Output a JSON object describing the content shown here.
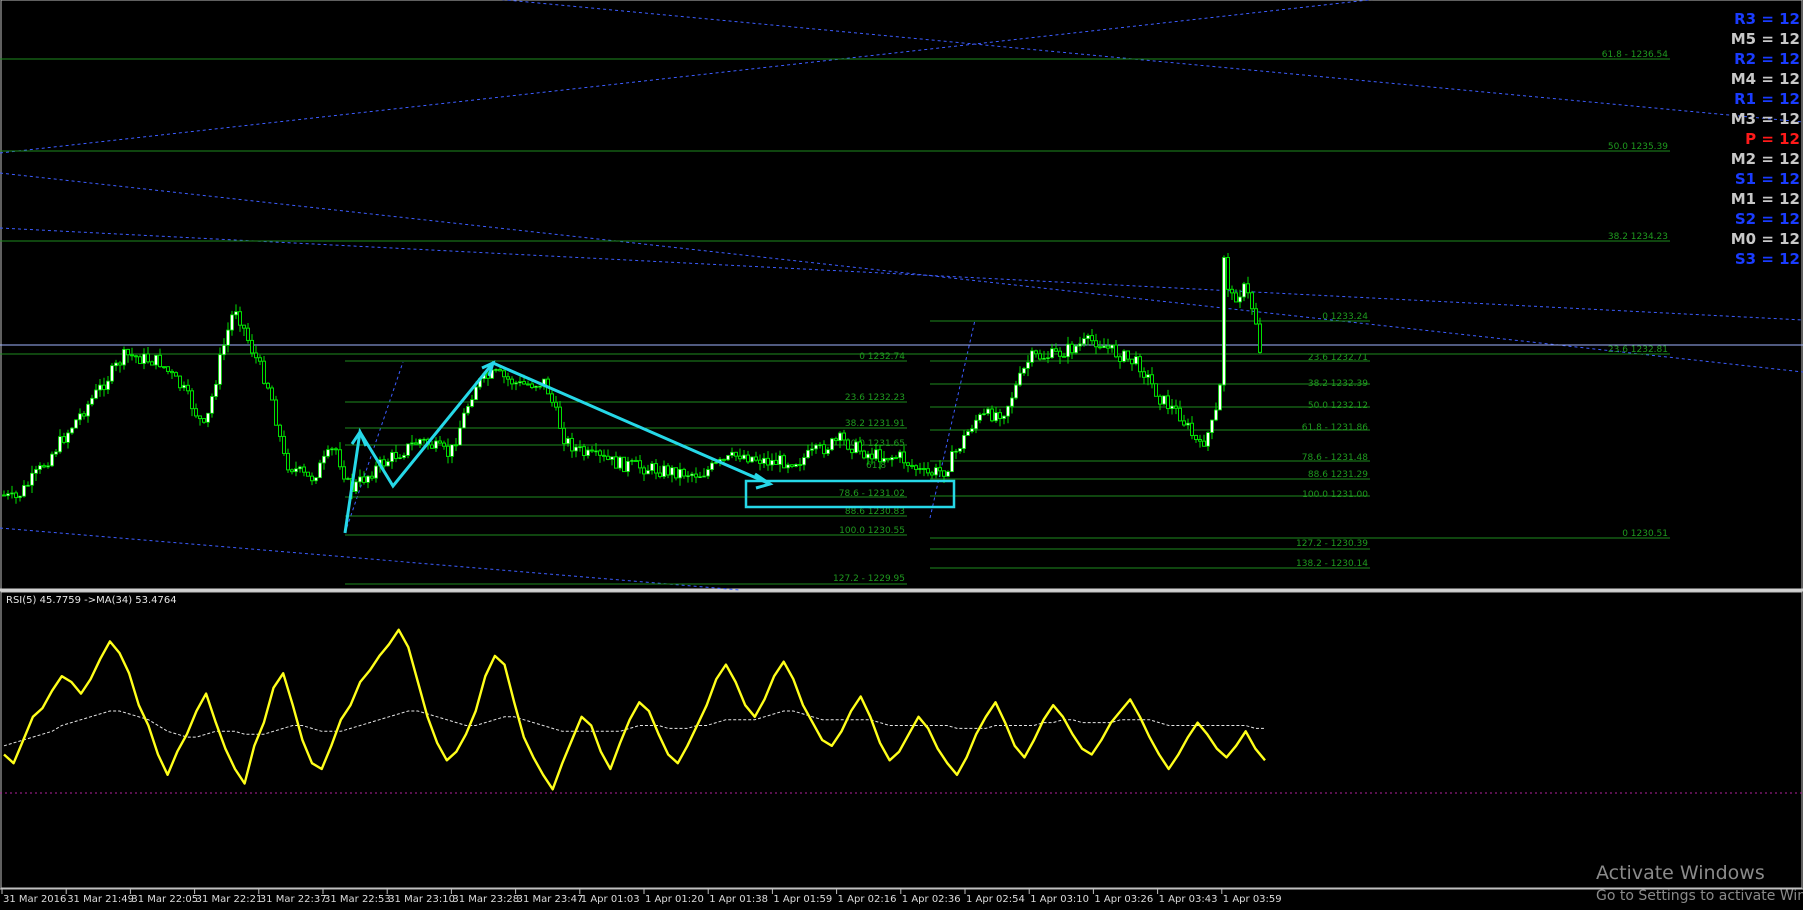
{
  "chart_data": [
    {
      "type": "line",
      "panel": "price",
      "description_in_chart": "",
      "pivots": [
        {
          "label": "R3 = 12",
          "color": "#1a3cff"
        },
        {
          "label": "M5 = 12",
          "color": "#c8c8c8"
        },
        {
          "label": "R2 = 12",
          "color": "#1a3cff"
        },
        {
          "label": "M4 = 12",
          "color": "#c8c8c8"
        },
        {
          "label": "R1 = 12",
          "color": "#1a3cff"
        },
        {
          "label": "M3 = 12",
          "color": "#c8c8c8"
        },
        {
          "label": "P  = 12",
          "color": "#ff1a1a"
        },
        {
          "label": "M2 = 12",
          "color": "#c8c8c8"
        },
        {
          "label": "S1 = 12",
          "color": "#1a3cff"
        },
        {
          "label": "M1 = 12",
          "color": "#c8c8c8"
        },
        {
          "label": "S2 = 12",
          "color": "#1a3cff"
        },
        {
          "label": "M0 = 12",
          "color": "#c8c8c8"
        },
        {
          "label": "S3 = 12",
          "color": "#1a3cff"
        }
      ],
      "fib_levels": [
        {
          "label": "61.8 - 1236.54"
        },
        {
          "label": "50.0 1235.39"
        },
        {
          "label": "38.2 1234.23"
        },
        {
          "label": "0 1233.24"
        },
        {
          "label": "23.6 1232.81"
        },
        {
          "label": "0 1232.74"
        },
        {
          "label": "23.6 1232.71"
        },
        {
          "label": "38.2 1232.39"
        },
        {
          "label": "23.6 1232.23"
        },
        {
          "label": "50.0 1232.12"
        },
        {
          "label": "38.2 1231.91"
        },
        {
          "label": "61.8 - 1231.86"
        },
        {
          "label": "50.0 1231.65"
        },
        {
          "label": "61.8"
        },
        {
          "label": "78.6 - 1231.48"
        },
        {
          "label": "88.6 1231.29"
        },
        {
          "label": "78.6 - 1231.02"
        },
        {
          "label": "100.0 1231.00"
        },
        {
          "label": "88.6 1230.83"
        },
        {
          "label": "100.0 1230.55"
        },
        {
          "label": "0 1230.51"
        },
        {
          "label": "127.2 - 1230.39"
        },
        {
          "label": "138.2 - 1230.14"
        },
        {
          "label": "127.2 - 1229.95"
        }
      ],
      "colors": {
        "candles": "#00e000",
        "fib": "#1e9a1e",
        "channel": "#3c5cff",
        "zigzag": "#26d8e8"
      }
    },
    {
      "type": "line",
      "panel": "rsi",
      "indicator_label": "RSI(5) 45.7759  ->MA(34) 53.4764",
      "series": [
        {
          "values": [
            45,
            42,
            50,
            58,
            61,
            67,
            72,
            70,
            66,
            71,
            78,
            84,
            80,
            73,
            62,
            55,
            45,
            38,
            46,
            52,
            60,
            66,
            56,
            47,
            40,
            35,
            48,
            56,
            68,
            73,
            62,
            50,
            42,
            40,
            48,
            57,
            62,
            70,
            74,
            79,
            83,
            88,
            82,
            70,
            58,
            49,
            43,
            46,
            52,
            60,
            72,
            79,
            76,
            63,
            51,
            44,
            38,
            33,
            42,
            50,
            58,
            55,
            46,
            40,
            49,
            57,
            63,
            60,
            52,
            45,
            42,
            48,
            55,
            62,
            71,
            76,
            70,
            62,
            58,
            64,
            72,
            77,
            71,
            62,
            56,
            50,
            48,
            53,
            60,
            65,
            58,
            49,
            43,
            46,
            52,
            58,
            54,
            47,
            42,
            38,
            44,
            52,
            58,
            63,
            56,
            48,
            44,
            50,
            57,
            62,
            58,
            52,
            47,
            45,
            50,
            56,
            60,
            64,
            58,
            51,
            45,
            40,
            45,
            51,
            56,
            52,
            47,
            44,
            48,
            53,
            47,
            43
          ]
        },
        {
          "values": [
            48,
            49,
            50,
            51,
            52,
            53,
            55,
            56,
            57,
            58,
            59,
            60,
            60,
            59,
            58,
            57,
            55,
            53,
            52,
            51,
            51,
            52,
            53,
            53,
            53,
            52,
            52,
            52,
            53,
            54,
            55,
            55,
            54,
            53,
            53,
            53,
            54,
            55,
            56,
            57,
            58,
            59,
            60,
            60,
            59,
            58,
            57,
            56,
            55,
            55,
            56,
            57,
            58,
            58,
            57,
            56,
            55,
            54,
            53,
            53,
            53,
            53,
            53,
            53,
            53,
            54,
            55,
            55,
            55,
            54,
            54,
            54,
            55,
            55,
            56,
            57,
            57,
            57,
            57,
            58,
            59,
            60,
            60,
            59,
            58,
            57,
            57,
            57,
            57,
            57,
            57,
            56,
            55,
            55,
            55,
            55,
            55,
            55,
            55,
            54,
            54,
            54,
            54,
            55,
            55,
            55,
            55,
            55,
            56,
            56,
            57,
            57,
            56,
            56,
            56,
            56,
            57,
            57,
            57,
            57,
            56,
            55,
            55,
            55,
            55,
            55,
            55,
            55,
            55,
            55,
            54,
            54
          ]
        }
      ],
      "colors": {
        "rsi": "#ffff1a",
        "ma": "#e6e6e6",
        "level": "#b0209a"
      }
    }
  ],
  "time_axis": {
    "labels": [
      "31 Mar 2016",
      "31 Mar 21:49",
      "31 Mar 22:05",
      "31 Mar 22:21",
      "31 Mar 22:37",
      "31 Mar 22:53",
      "31 Mar 23:10",
      "31 Mar 23:28",
      "31 Mar 23:47",
      "1 Apr 01:03",
      "1 Apr 01:20",
      "1 Apr 01:38",
      "1 Apr 01:59",
      "1 Apr 02:16",
      "1 Apr 02:36",
      "1 Apr 02:54",
      "1 Apr 03:10",
      "1 Apr 03:26",
      "1 Apr 03:43",
      "1 Apr 03:59"
    ]
  },
  "watermark": {
    "line1": "Activate Windows",
    "line2": "Go to Settings to activate Wind"
  }
}
